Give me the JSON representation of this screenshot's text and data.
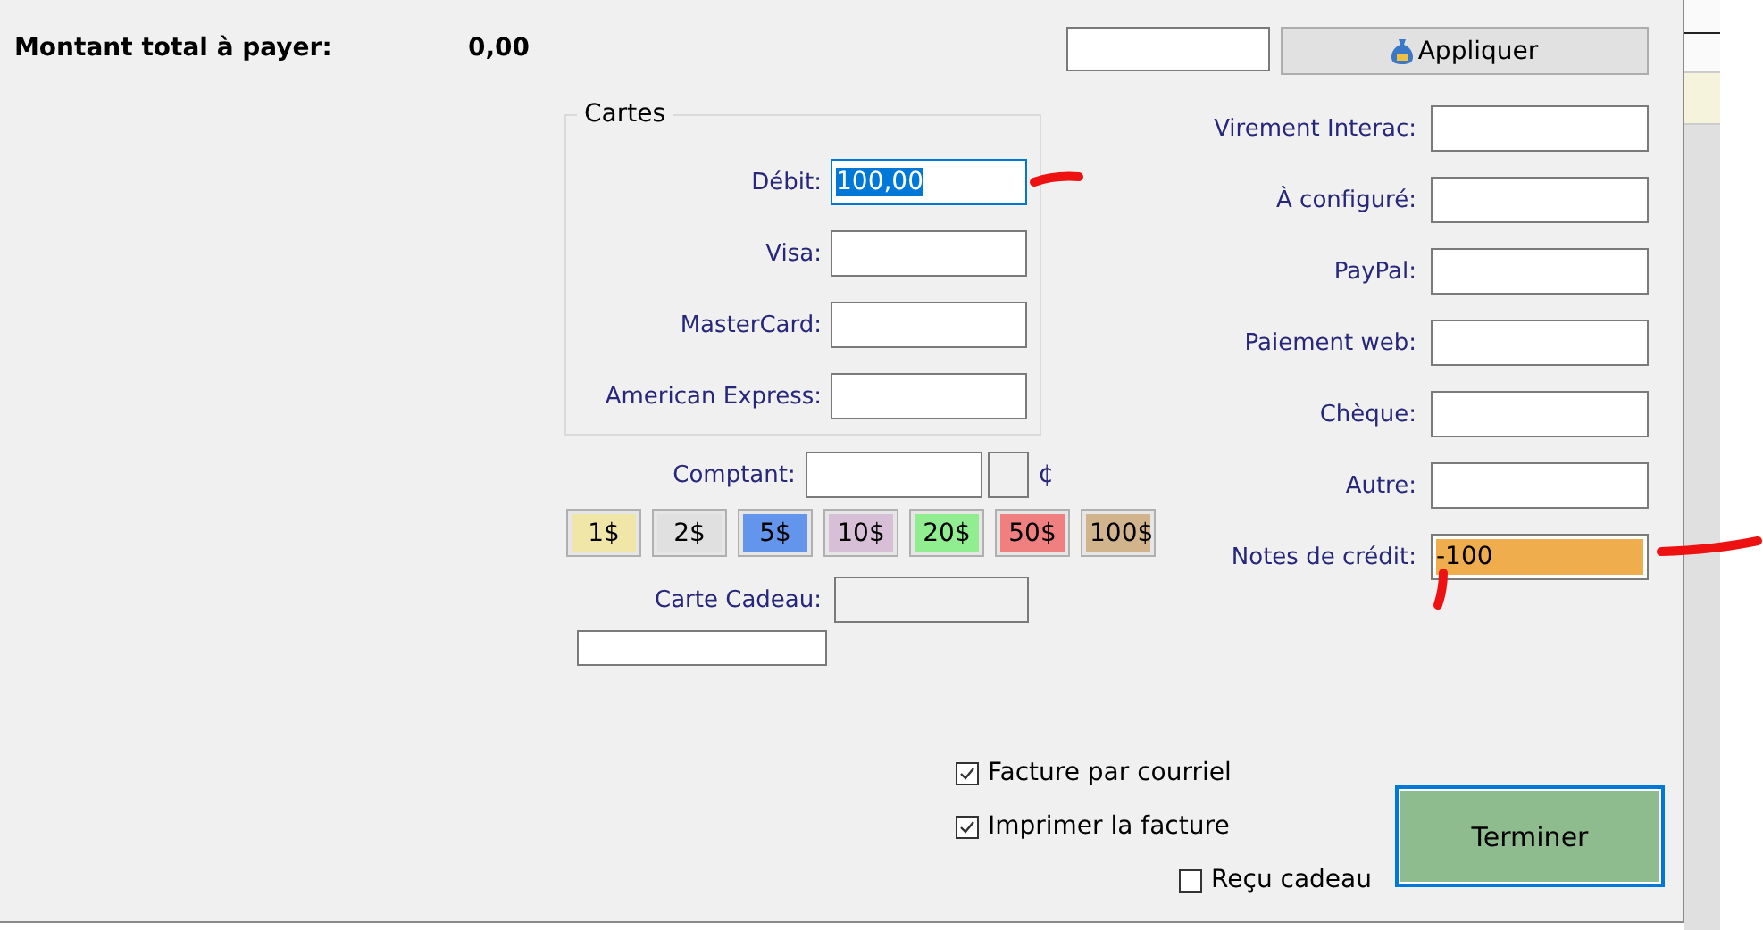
{
  "summary": {
    "label": "Montant total à payer:",
    "amount": "0,00"
  },
  "apply_button": {
    "label": "Appliquer"
  },
  "cards_group": {
    "title": "Cartes",
    "fields": [
      {
        "label": "Débit:",
        "value": "100,00",
        "focused": true
      },
      {
        "label": "Visa:",
        "focused": false
      },
      {
        "label": "MasterCard:",
        "focused": false
      },
      {
        "label": "American Express:",
        "focused": false
      }
    ]
  },
  "cash": {
    "label": "Comptant:",
    "cents_symbol": "¢"
  },
  "bills": [
    {
      "label": "1$",
      "color": "#f0e6a8"
    },
    {
      "label": "2$",
      "color": "#e0e0e0"
    },
    {
      "label": "5$",
      "color": "#6495ed"
    },
    {
      "label": "10$",
      "color": "#d8bfd8"
    },
    {
      "label": "20$",
      "color": "#90ee90"
    },
    {
      "label": "50$",
      "color": "#f08080"
    },
    {
      "label": "100$",
      "color": "#d2b48c"
    }
  ],
  "gift_card": {
    "label": "Carte Cadeau:",
    "disabled": true
  },
  "other_methods": [
    {
      "label": "Virement Interac:",
      "highlighted": false
    },
    {
      "label": "À configuré:",
      "highlighted": false
    },
    {
      "label": "PayPal:",
      "highlighted": false
    },
    {
      "label": "Paiement web:",
      "highlighted": false
    },
    {
      "label": "Chèque:",
      "highlighted": false
    },
    {
      "label": "Autre:",
      "highlighted": false
    },
    {
      "label": "Notes de crédit:",
      "value": "-100",
      "highlighted": true
    }
  ],
  "options": [
    {
      "label": "Facture par courriel",
      "checked": true
    },
    {
      "label": "Imprimer la facture",
      "checked": true
    },
    {
      "label": "Reçu cadeau",
      "checked": false
    }
  ],
  "finish_button": {
    "label": "Terminer"
  }
}
